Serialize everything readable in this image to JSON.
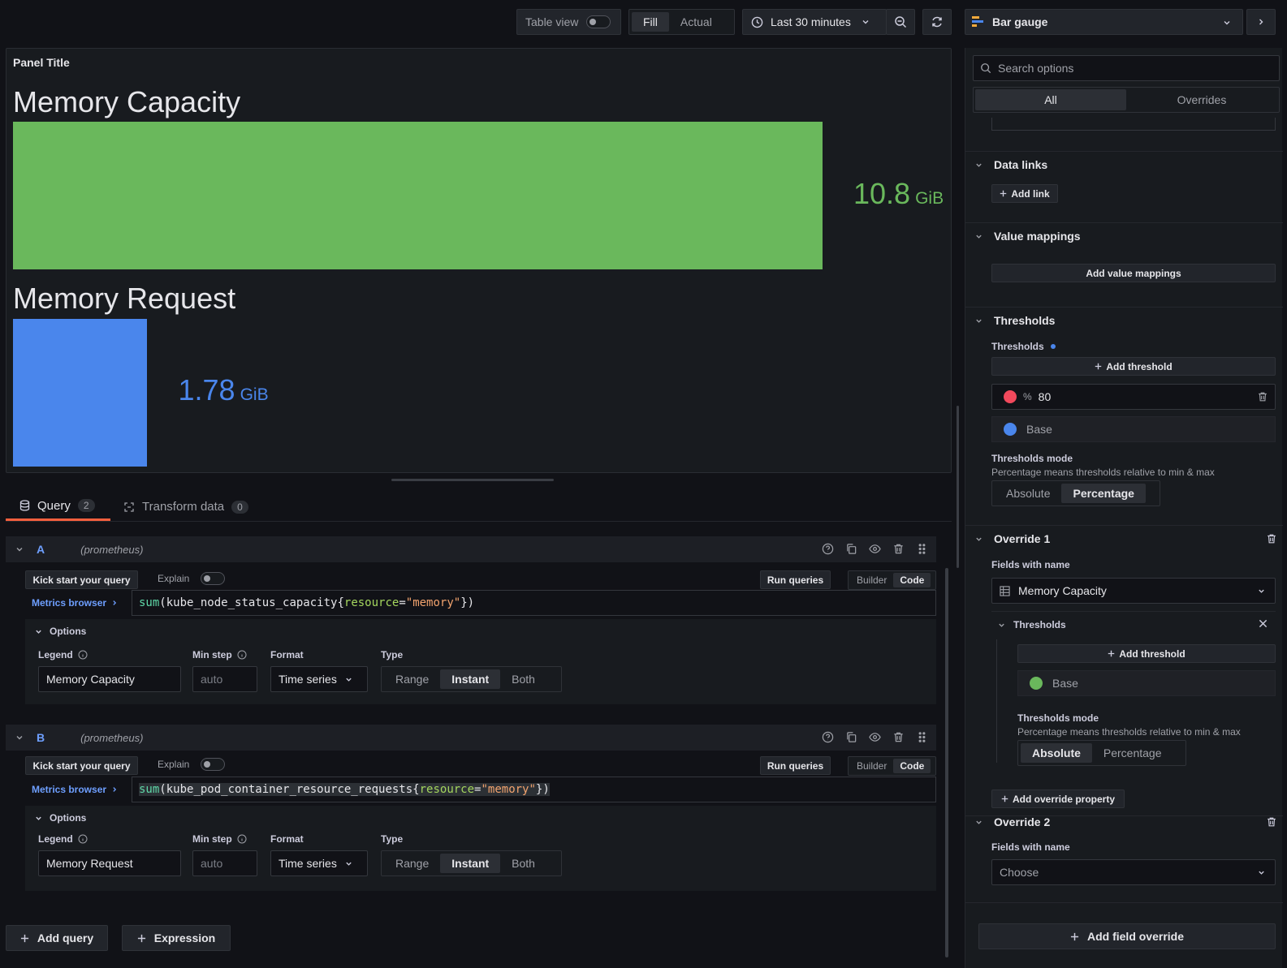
{
  "toolbar": {
    "table_view_label": "Table view",
    "fill_label": "Fill",
    "actual_label": "Actual",
    "time_range_label": "Last 30 minutes",
    "visualization_label": "Bar gauge"
  },
  "panel": {
    "title": "Panel Title",
    "gauges": [
      {
        "name": "Memory Capacity",
        "value": "10.8",
        "unit": "GiB",
        "color": "#6ab85c",
        "fill_fraction": 1.0
      },
      {
        "name": "Memory Request",
        "value": "1.78",
        "unit": "GiB",
        "color": "#4a86ec",
        "fill_fraction": 0.165
      }
    ]
  },
  "tabs": {
    "query_label": "Query",
    "query_count": "2",
    "transform_label": "Transform data",
    "transform_count": "0"
  },
  "queries": [
    {
      "ref": "A",
      "datasource": "(prometheus)",
      "kick_start": "Kick start your query",
      "explain": "Explain",
      "run": "Run queries",
      "builder": "Builder",
      "code": "Code",
      "metrics_browser": "Metrics browser",
      "fn": "sum",
      "metric": "kube_node_status_capacity",
      "label_key": "resource",
      "label_value": "\"memory\"",
      "options_label": "Options",
      "legend_label": "Legend",
      "legend_value": "Memory Capacity",
      "min_step_label": "Min step",
      "min_step_placeholder": "auto",
      "format_label": "Format",
      "format_value": "Time series",
      "type_label": "Type",
      "type_range": "Range",
      "type_instant": "Instant",
      "type_both": "Both"
    },
    {
      "ref": "B",
      "datasource": "(prometheus)",
      "kick_start": "Kick start your query",
      "explain": "Explain",
      "run": "Run queries",
      "builder": "Builder",
      "code": "Code",
      "metrics_browser": "Metrics browser",
      "fn": "sum",
      "metric": "kube_pod_container_resource_requests",
      "label_key": "resource",
      "label_value": "\"memory\"",
      "options_label": "Options",
      "legend_label": "Legend",
      "legend_value": "Memory Request",
      "min_step_label": "Min step",
      "min_step_placeholder": "auto",
      "format_label": "Format",
      "format_value": "Time series",
      "type_label": "Type",
      "type_range": "Range",
      "type_instant": "Instant",
      "type_both": "Both"
    }
  ],
  "bottom": {
    "add_query": "Add query",
    "expression": "Expression"
  },
  "options_pane": {
    "search_placeholder": "Search options",
    "tab_all": "All",
    "tab_overrides": "Overrides",
    "data_links": {
      "title": "Data links",
      "add_link": "Add link"
    },
    "value_mappings": {
      "title": "Value mappings",
      "add": "Add value mappings"
    },
    "thresholds": {
      "title": "Thresholds",
      "label": "Thresholds",
      "add": "Add threshold",
      "step_symbol": "%",
      "step_value": "80",
      "step_color": "#f2495c",
      "base_label": "Base",
      "base_color": "#4a86ec",
      "mode_label": "Thresholds mode",
      "mode_desc": "Percentage means thresholds relative to min & max",
      "mode_absolute": "Absolute",
      "mode_percentage": "Percentage"
    },
    "override1": {
      "title": "Override 1",
      "fields_label": "Fields with name",
      "field_value": "Memory Capacity",
      "thresholds_title": "Thresholds",
      "add_threshold": "Add threshold",
      "base_label": "Base",
      "base_color": "#6ab85c",
      "mode_label": "Thresholds mode",
      "mode_desc": "Percentage means thresholds relative to min & max",
      "mode_absolute": "Absolute",
      "mode_percentage": "Percentage",
      "add_property": "Add override property"
    },
    "override2": {
      "title": "Override 2",
      "fields_label": "Fields with name",
      "field_placeholder": "Choose"
    },
    "add_field_override": "Add field override"
  }
}
